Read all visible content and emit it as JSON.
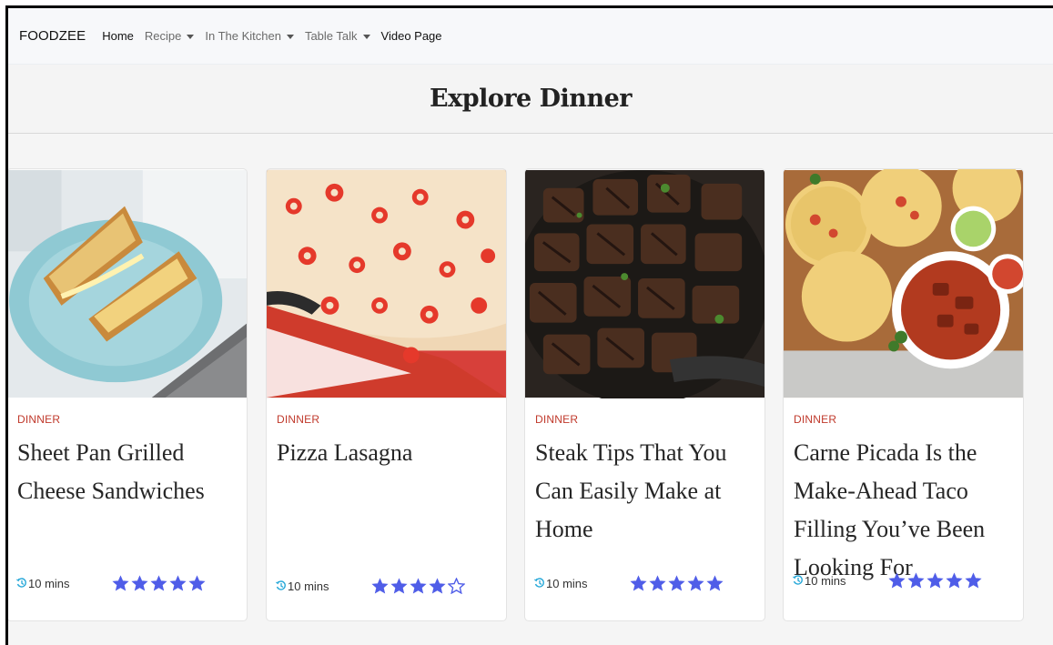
{
  "navbar": {
    "brand": "FOODZEE",
    "links": [
      {
        "label": "Home",
        "dropdown": false
      },
      {
        "label": "Recipe",
        "dropdown": true
      },
      {
        "label": "In The Kitchen",
        "dropdown": true
      },
      {
        "label": "Table Talk",
        "dropdown": true
      },
      {
        "label": "Video Page",
        "dropdown": false
      }
    ]
  },
  "page": {
    "title": "Explore Dinner"
  },
  "colors": {
    "accent_red": "#c0392b",
    "star": "#4f5de8",
    "clock": "#29a9d9"
  },
  "cards": [
    {
      "category": "DINNER",
      "title": "Sheet Pan Grilled Cheese Sandwiches",
      "time": "10 mins",
      "rating": 5,
      "image": "grilled-cheese-image"
    },
    {
      "category": "DINNER",
      "title": "Pizza Lasagna",
      "time": "10 mins",
      "rating": 4,
      "image": "pizza-lasagna-image"
    },
    {
      "category": "DINNER",
      "title": "Steak Tips That You Can Easily Make at Home",
      "time": "10 mins",
      "rating": 5,
      "image": "steak-tips-image"
    },
    {
      "category": "DINNER",
      "title": "Carne Picada Is the Make-Ahead Taco Filling You’ve Been Looking For",
      "time": "10 mins",
      "rating": 5,
      "image": "carne-picada-image"
    }
  ]
}
